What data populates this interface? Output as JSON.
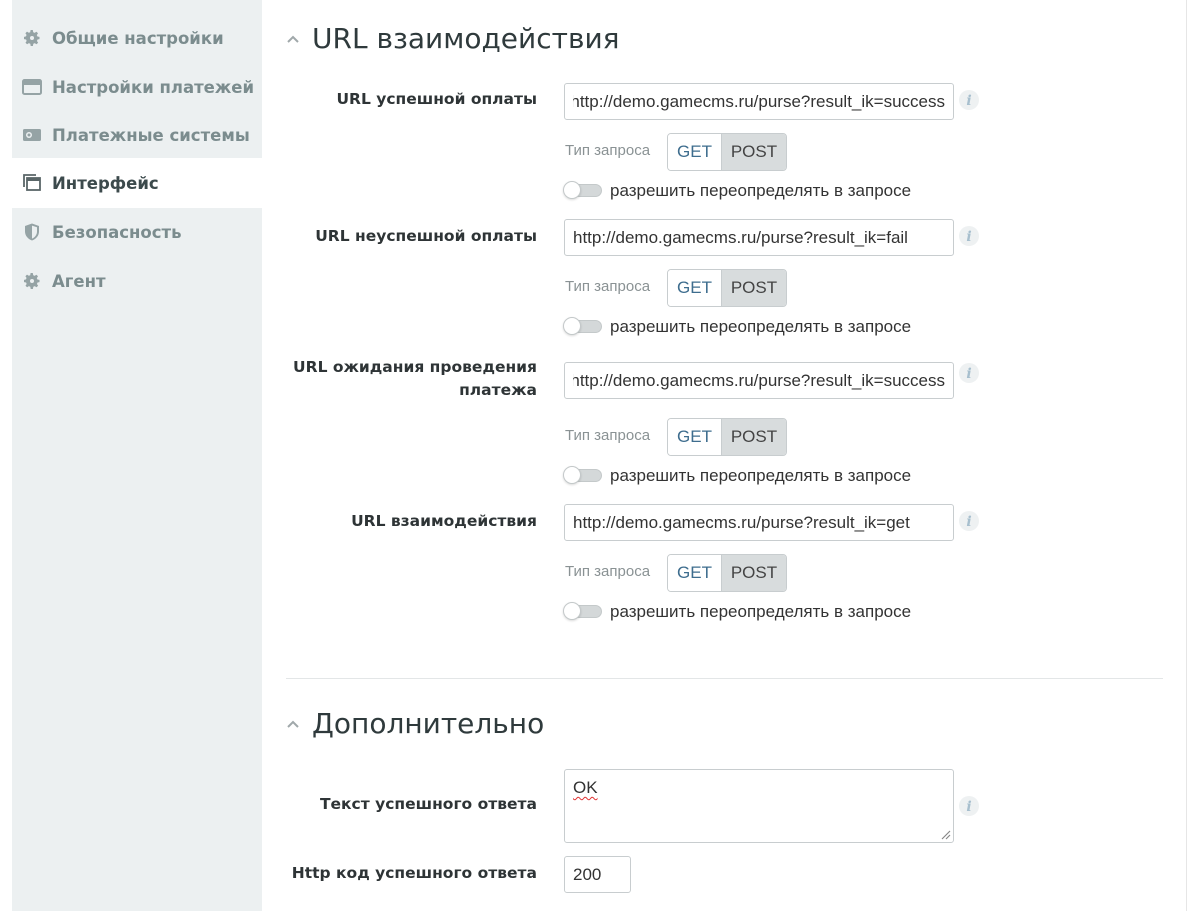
{
  "sidebar": {
    "items": [
      {
        "label": "Общие настройки",
        "icon": "gear-icon",
        "active": false
      },
      {
        "label": "Настройки платежей",
        "icon": "window-icon",
        "active": false
      },
      {
        "label": "Платежные системы",
        "icon": "card-icon",
        "active": false
      },
      {
        "label": "Интерфейс",
        "icon": "copy-window-icon",
        "active": true
      },
      {
        "label": "Безопасность",
        "icon": "shield-icon",
        "active": false
      },
      {
        "label": "Агент",
        "icon": "gear-icon",
        "active": false
      }
    ]
  },
  "sections": {
    "interaction": {
      "title": "URL взаимодействия",
      "fields": [
        {
          "label": "URL успешной оплаты",
          "value": "http://demo.gamecms.ru/purse?result_ik=success",
          "method_label": "Тип запроса",
          "get": "GET",
          "post": "POST",
          "selected": "POST",
          "override_label": "разрешить переопределять в запросе"
        },
        {
          "label": "URL неуспешной оплаты",
          "value": "http://demo.gamecms.ru/purse?result_ik=fail",
          "method_label": "Тип запроса",
          "get": "GET",
          "post": "POST",
          "selected": "POST",
          "override_label": "разрешить переопределять в запросе"
        },
        {
          "label_line1": "URL ожидания проведения",
          "label_line2": "платежа",
          "value": "http://demo.gamecms.ru/purse?result_ik=success",
          "method_label": "Тип запроса",
          "get": "GET",
          "post": "POST",
          "selected": "POST",
          "override_label": "разрешить переопределять в запросе"
        },
        {
          "label": "URL взаимодействия",
          "value": "http://demo.gamecms.ru/purse?result_ik=get",
          "method_label": "Тип запроса",
          "get": "GET",
          "post": "POST",
          "selected": "POST",
          "override_label": "разрешить переопределять в запросе"
        }
      ]
    },
    "additional": {
      "title": "Дополнительно",
      "success_text_label": "Текст успешного ответа",
      "success_text_value": "OK",
      "http_code_label": "Http код успешного ответа",
      "http_code_value": "200"
    }
  },
  "colors": {
    "sidebar_bg": "#ecf0f1",
    "sidebar_text": "#7b8c8e",
    "active_text": "#3c4a4c",
    "get_text": "#3e6d8e",
    "post_bg": "#d8dcdd"
  }
}
